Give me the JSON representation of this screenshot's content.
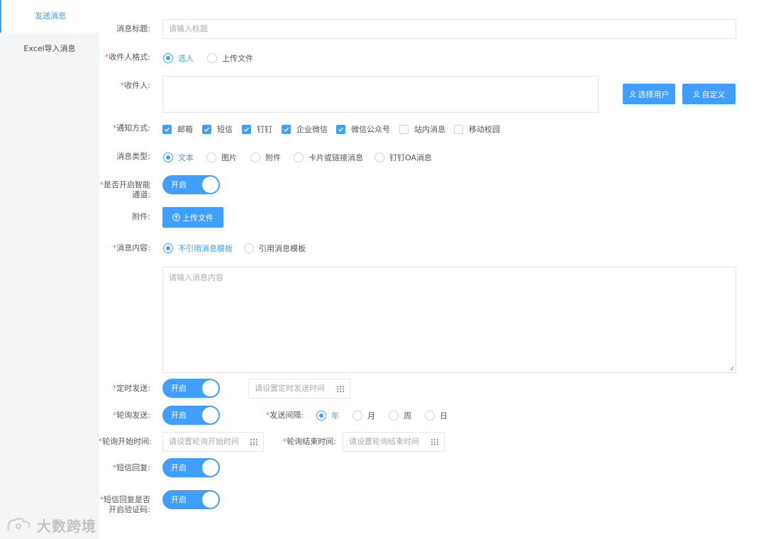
{
  "sidebar": {
    "items": [
      {
        "label": "发送消息"
      },
      {
        "label": "Excel导入消息"
      }
    ]
  },
  "form": {
    "title": {
      "label": "消息标题:",
      "placeholder": "请输入标题"
    },
    "recipient_format": {
      "label": "收件人格式:",
      "options": [
        "选人",
        "上传文件"
      ],
      "selected": "选人"
    },
    "recipients": {
      "label": "收件人:",
      "select_user_button": "选择用户",
      "custom_button": "自定义"
    },
    "notify_methods": {
      "label": "通知方式:",
      "options": [
        {
          "label": "邮箱",
          "checked": true
        },
        {
          "label": "短信",
          "checked": true
        },
        {
          "label": "钉钉",
          "checked": true
        },
        {
          "label": "企业微信",
          "checked": true
        },
        {
          "label": "微信公众号",
          "checked": true
        },
        {
          "label": "站内消息",
          "checked": false
        },
        {
          "label": "移动校园",
          "checked": false
        }
      ]
    },
    "message_type": {
      "label": "消息类型:",
      "options": [
        "文本",
        "图片",
        "附件",
        "卡片或链接消息",
        "钉钉OA消息"
      ],
      "selected": "文本"
    },
    "smart_channel": {
      "label_line1": "是否开启智能",
      "label_line2": "通道:",
      "toggle": "开启",
      "on": true
    },
    "attachment": {
      "label": "附件:",
      "upload_button": "上传文件"
    },
    "content": {
      "label": "消息内容:",
      "options": [
        "不引用消息模板",
        "引用消息模板"
      ],
      "selected": "不引用消息模板",
      "placeholder": "请输入消息内容"
    },
    "scheduled_send": {
      "label": "定时发送:",
      "toggle": "开启",
      "on": true,
      "time_placeholder": "请设置定时发送时间"
    },
    "polling_send": {
      "label": "轮询发送:",
      "toggle": "开启",
      "on": true
    },
    "send_interval": {
      "label": "发送间隔:",
      "options": [
        "年",
        "月",
        "周",
        "日"
      ],
      "selected": "年"
    },
    "polling_start": {
      "label": "轮询开始时间:",
      "placeholder": "请设置轮询开始时间"
    },
    "polling_end": {
      "label": "轮询结束时间:",
      "placeholder": "请设置轮询结束时间"
    },
    "sms_reply": {
      "label": "短信回复:",
      "toggle": "开启",
      "on": true
    },
    "sms_verify": {
      "label_line1": "短信回复是否",
      "label_line2": "开启验证码:",
      "toggle": "开启",
      "on": true
    }
  },
  "watermark": {
    "text": "大数跨境"
  },
  "colors": {
    "accent": "#409eff",
    "required": "#f56c6c"
  }
}
